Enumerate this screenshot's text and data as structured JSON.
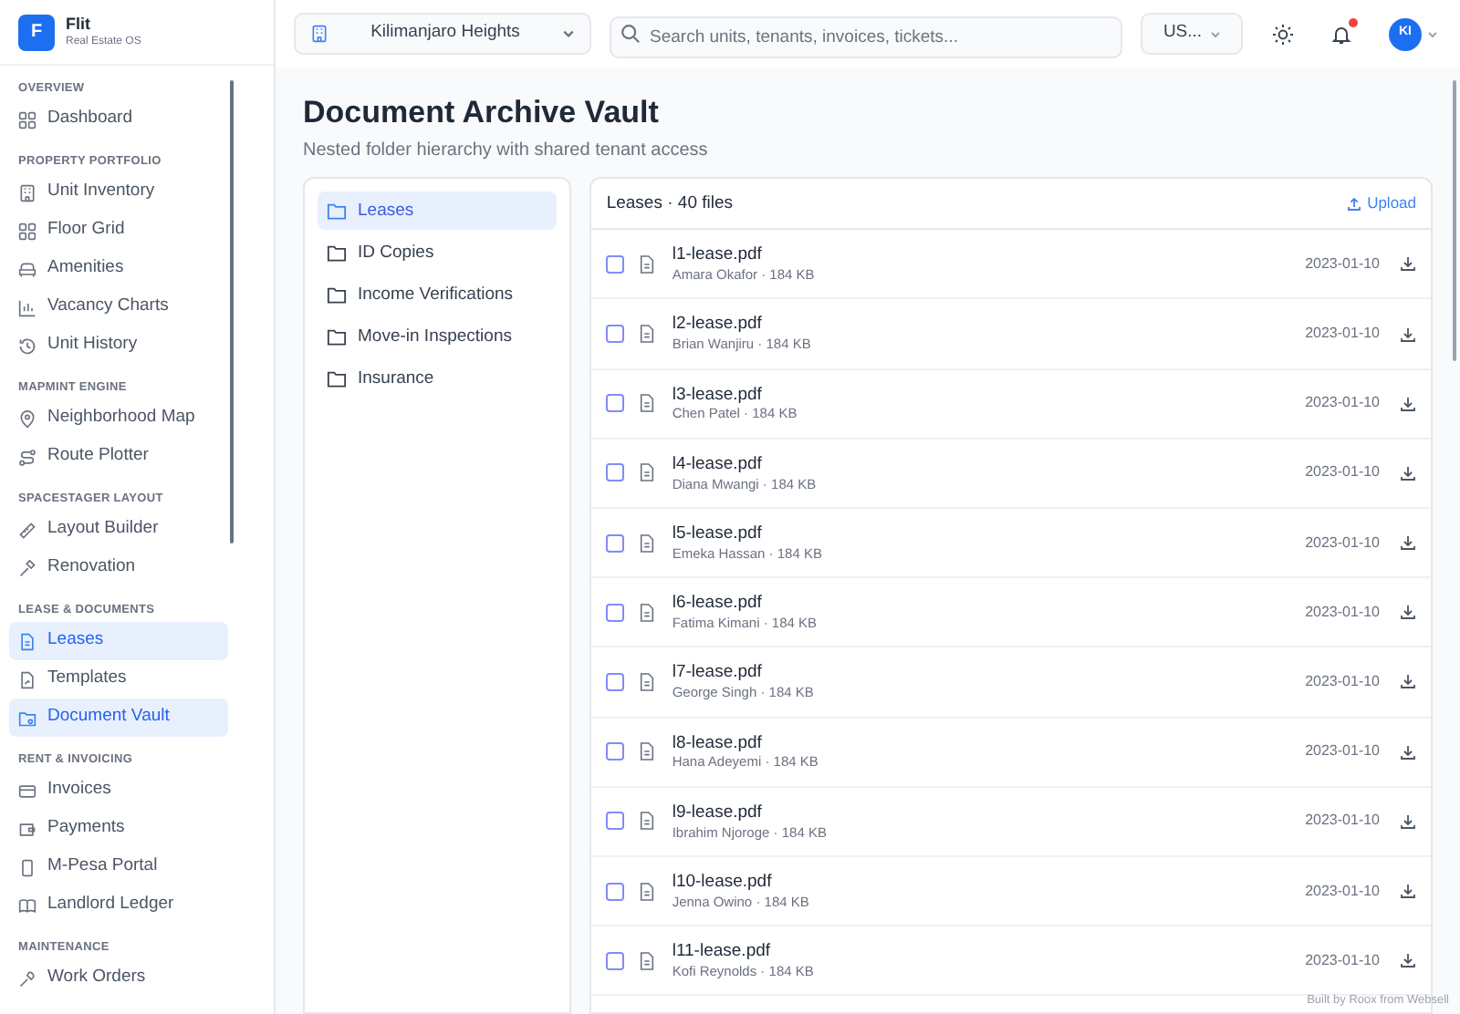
{
  "brand": {
    "logo": "F",
    "name": "Flit",
    "tagline": "Real Estate OS"
  },
  "sidebar": {
    "sections": [
      {
        "label": "OVERVIEW",
        "items": [
          {
            "label": "Dashboard",
            "selected": false
          }
        ]
      },
      {
        "label": "PROPERTY PORTFOLIO",
        "items": [
          {
            "label": "Unit Inventory",
            "selected": false
          },
          {
            "label": "Floor Grid",
            "selected": false
          },
          {
            "label": "Amenities",
            "selected": false
          },
          {
            "label": "Vacancy Charts",
            "selected": false
          },
          {
            "label": "Unit History",
            "selected": false
          }
        ]
      },
      {
        "label": "MAPMINT ENGINE",
        "items": [
          {
            "label": "Neighborhood Map",
            "selected": false
          },
          {
            "label": "Route Plotter",
            "selected": false
          }
        ]
      },
      {
        "label": "SPACESTAGER LAYOUT",
        "items": [
          {
            "label": "Layout Builder",
            "selected": false
          },
          {
            "label": "Renovation",
            "selected": false
          }
        ]
      },
      {
        "label": "LEASE & DOCUMENTS",
        "items": [
          {
            "label": "Leases",
            "selected": true
          },
          {
            "label": "Templates",
            "selected": false
          },
          {
            "label": "Document Vault",
            "selected": true
          }
        ]
      },
      {
        "label": "RENT & INVOICING",
        "items": [
          {
            "label": "Invoices",
            "selected": false
          },
          {
            "label": "Payments",
            "selected": false
          },
          {
            "label": "M-Pesa Portal",
            "selected": false
          },
          {
            "label": "Landlord Ledger",
            "selected": false
          }
        ]
      },
      {
        "label": "MAINTENANCE",
        "items": [
          {
            "label": "Work Orders",
            "selected": false
          }
        ]
      }
    ]
  },
  "topbar": {
    "property": "Kilimanjaro Heights",
    "search": {
      "placeholder": "Search units, tenants, invoices, tickets..."
    },
    "currency": "US...",
    "notifications": true,
    "avatar": "KI"
  },
  "page": {
    "title": "Document Archive Vault",
    "subtitle": "Nested folder hierarchy with shared tenant access"
  },
  "folders": [
    {
      "label": "Leases",
      "selected": true
    },
    {
      "label": "ID Copies",
      "selected": false
    },
    {
      "label": "Income Verifications",
      "selected": false
    },
    {
      "label": "Move-in Inspections",
      "selected": false
    },
    {
      "label": "Insurance",
      "selected": false
    }
  ],
  "files": {
    "heading": "Leases · 40 files",
    "upload": "Upload",
    "rows": [
      {
        "name": "l1-lease.pdf",
        "meta": "Amara Okafor · 184 KB",
        "date": "2023-01-10",
        "checked": false
      },
      {
        "name": "l2-lease.pdf",
        "meta": "Brian Wanjiru · 184 KB",
        "date": "2023-01-10",
        "checked": false
      },
      {
        "name": "l3-lease.pdf",
        "meta": "Chen Patel · 184 KB",
        "date": "2023-01-10",
        "checked": false
      },
      {
        "name": "l4-lease.pdf",
        "meta": "Diana Mwangi · 184 KB",
        "date": "2023-01-10",
        "checked": false
      },
      {
        "name": "l5-lease.pdf",
        "meta": "Emeka Hassan · 184 KB",
        "date": "2023-01-10",
        "checked": false
      },
      {
        "name": "l6-lease.pdf",
        "meta": "Fatima Kimani · 184 KB",
        "date": "2023-01-10",
        "checked": false
      },
      {
        "name": "l7-lease.pdf",
        "meta": "George Singh · 184 KB",
        "date": "2023-01-10",
        "checked": false
      },
      {
        "name": "l8-lease.pdf",
        "meta": "Hana Adeyemi · 184 KB",
        "date": "2023-01-10",
        "checked": false
      },
      {
        "name": "l9-lease.pdf",
        "meta": "Ibrahim Njoroge · 184 KB",
        "date": "2023-01-10",
        "checked": false
      },
      {
        "name": "l10-lease.pdf",
        "meta": "Jenna Owino · 184 KB",
        "date": "2023-01-10",
        "checked": false
      },
      {
        "name": "l11-lease.pdf",
        "meta": "Kofi Reynolds · 184 KB",
        "date": "2023-01-10",
        "checked": false
      }
    ]
  },
  "footer_badge": "Built by Roox from Websell"
}
